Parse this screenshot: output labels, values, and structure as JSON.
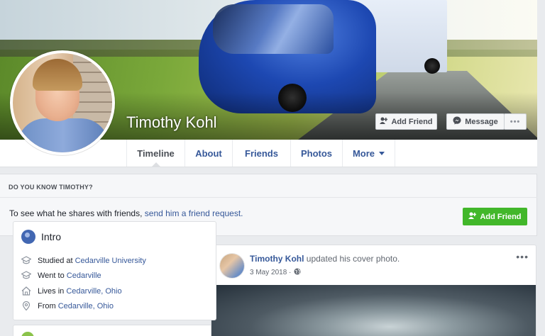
{
  "profile": {
    "name": "Timothy Kohl",
    "add_friend_label": "Add Friend",
    "message_label": "Message",
    "more_label": "•••"
  },
  "tabs": [
    {
      "label": "Timeline",
      "active": true
    },
    {
      "label": "About"
    },
    {
      "label": "Friends"
    },
    {
      "label": "Photos"
    },
    {
      "label": "More"
    }
  ],
  "know": {
    "heading": "DO YOU KNOW TIMOTHY?",
    "text_prefix": "To see what he shares with friends, ",
    "link": "send him a friend request.",
    "button_label": "Add Friend"
  },
  "intro": {
    "title": "Intro",
    "rows": [
      {
        "icon": "graduation-cap-icon",
        "prefix": "Studied at ",
        "link": "Cedarville University"
      },
      {
        "icon": "graduation-cap-icon",
        "prefix": "Went to ",
        "link": "Cedarville"
      },
      {
        "icon": "home-icon",
        "prefix": "Lives in ",
        "link": "Cedarville, Ohio"
      },
      {
        "icon": "location-pin-icon",
        "prefix": "From ",
        "link": "Cedarville, Ohio"
      }
    ]
  },
  "post": {
    "author": "Timothy Kohl",
    "action": " updated his cover photo.",
    "date": "3 May 2018 ·",
    "menu": "•••"
  },
  "colors": {
    "link": "#365899",
    "green": "#42b72a",
    "background": "#e9ebee"
  }
}
